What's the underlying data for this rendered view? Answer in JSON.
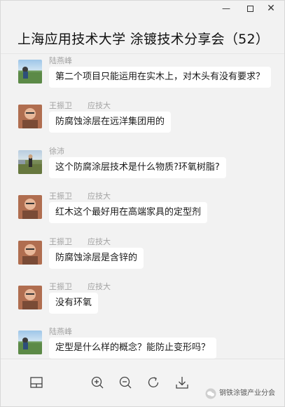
{
  "window": {
    "controls": {
      "minimize": "—",
      "close": "✕"
    }
  },
  "chat": {
    "title": "上海应用技术大学 涂镀技术分享会（52）"
  },
  "messages": [
    {
      "sender": "陆燕峰",
      "org": "",
      "avatar": "landscape-photo",
      "text": "第二个项目只能运用在实木上，对木头有没有要求？"
    },
    {
      "sender": "王振卫",
      "org": "应技大",
      "avatar": "portrait-photo",
      "text": "防腐蚀涂层在远洋集团用的"
    },
    {
      "sender": "徐沛",
      "org": "",
      "avatar": "outdoor-photo",
      "text": "这个防腐涂层技术是什么物质?环氧树脂?"
    },
    {
      "sender": "王振卫",
      "org": "应技大",
      "avatar": "portrait-photo",
      "text": "红木这个最好用在高端家具的定型剂"
    },
    {
      "sender": "王振卫",
      "org": "应技大",
      "avatar": "portrait-photo",
      "text": "防腐蚀涂层是含锌的"
    },
    {
      "sender": "王振卫",
      "org": "应技大",
      "avatar": "portrait-photo",
      "text": "没有环氧"
    },
    {
      "sender": "陆燕峰",
      "org": "",
      "avatar": "landscape-photo",
      "text": "定型是什么样的概念？能防止变形吗？"
    }
  ],
  "toolbar": {
    "icons": [
      "sidebar-layout-icon",
      "zoom-in-icon",
      "zoom-out-icon",
      "rotate-icon",
      "download-icon"
    ]
  },
  "watermark": {
    "text": "钢铁涂镀产业分会"
  }
}
